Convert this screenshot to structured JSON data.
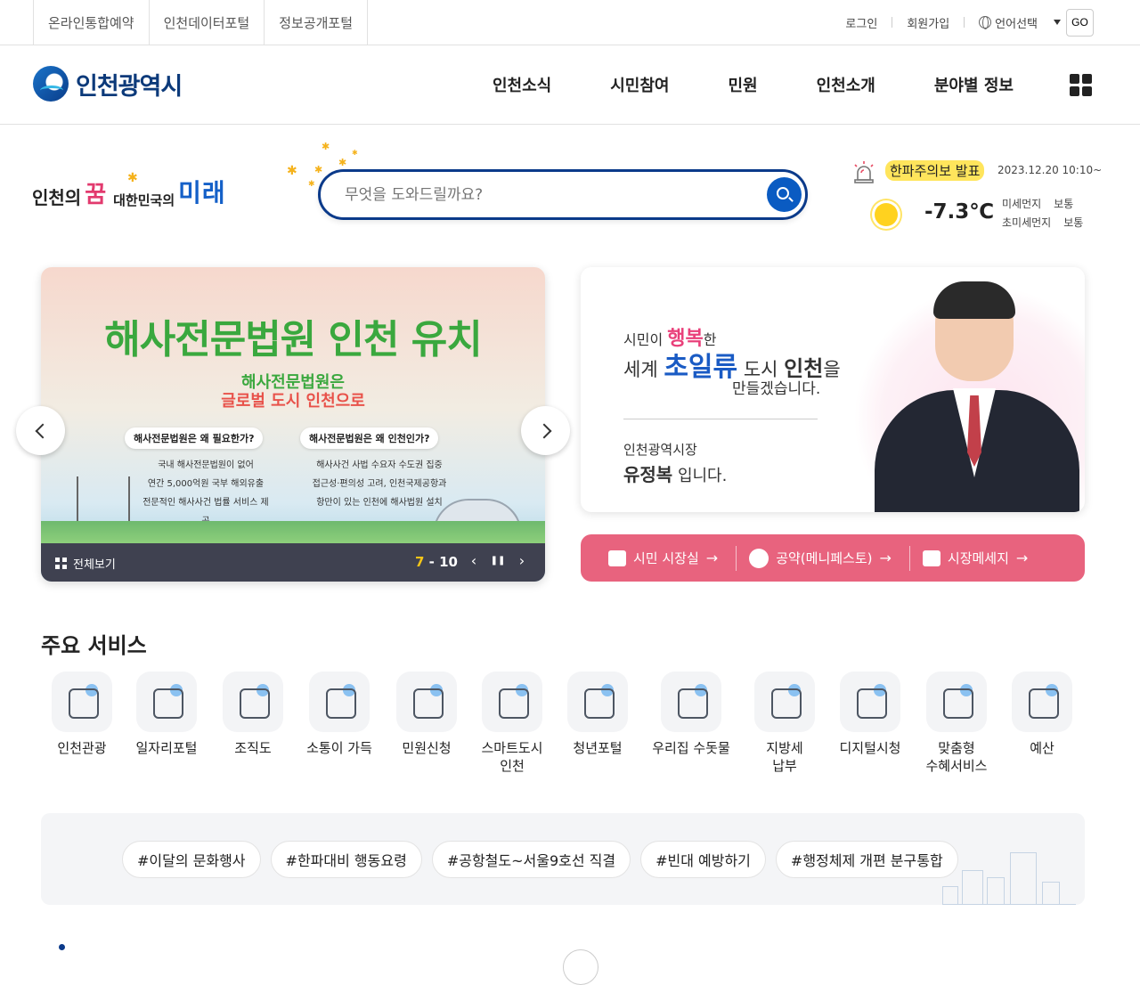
{
  "util": {
    "links": [
      "온라인통합예약",
      "인천데이터포털",
      "정보공개포털"
    ],
    "login": "로그인",
    "signup": "회원가입",
    "language": "언어선택",
    "go": "GO"
  },
  "header": {
    "logo_text": "인천광역시",
    "nav": [
      "인천소식",
      "시민참여",
      "민원",
      "인천소개",
      "분야별 정보"
    ]
  },
  "slogan": {
    "part1": "인천의",
    "part2": "꿈",
    "part3": "대한민국의",
    "part4": "미래"
  },
  "search": {
    "placeholder": "무엇을 도와드릴까요?"
  },
  "weather": {
    "alert": "한파주의보 발표",
    "datetime": "2023.12.20 10:10~",
    "temperature": "-7.3℃",
    "dust_label": "미세먼지",
    "dust_value": "보통",
    "fine_dust_label": "초미세먼지",
    "fine_dust_value": "보통"
  },
  "slider": {
    "title": "해사전문법원 인천 유치",
    "subtitle1": "해사전문법원은",
    "subtitle2": "글로벌 도시 인천으로",
    "q1": "해사전문법원은 왜 필요한가?",
    "q2": "해사전문법원은 왜 인천인가?",
    "col1": [
      "국내 해사전문법원이 없어",
      "연간 5,000억원 국부 해외유출",
      "전문적인 해사사건 법률 서비스 제공"
    ],
    "col2": [
      "해사사건 사법 수요자 수도권 집중",
      "접근성·편의성 고려, 인천국제공항과",
      "항만이 있는 인천에 해사법원 설치"
    ],
    "view_all": "전체보기",
    "current": "7",
    "total": "10",
    "prev": "‹",
    "pause": "❚❚",
    "next": "›"
  },
  "mayor": {
    "line1_a": "시민이",
    "line1_b": "행복",
    "line1_c": "한",
    "line2_a": "세계",
    "line2_b": "초일류",
    "line2_c": "도시",
    "line2_d": "인천",
    "line2_e": "을",
    "line3": "만들겠습니다.",
    "role": "인천광역시장",
    "name": "유정복",
    "name_suffix": "입니다.",
    "links": [
      "시민 시장실",
      "공약(메니페스토)",
      "시장메세지"
    ]
  },
  "services": {
    "title": "주요 서비스",
    "items": [
      [
        "인천관광"
      ],
      [
        "일자리포털"
      ],
      [
        "조직도"
      ],
      [
        "소통이 가득"
      ],
      [
        "민원신청"
      ],
      [
        "스마트도시",
        "인천"
      ],
      [
        "청년포털"
      ],
      [
        "우리집 수돗물"
      ],
      [
        "지방세",
        "납부"
      ],
      [
        "디지털시청"
      ],
      [
        "맞춤형",
        "수혜서비스"
      ],
      [
        "예산"
      ]
    ]
  },
  "hashtags": [
    "#이달의 문화행사",
    "#한파대비 행동요령",
    "#공항철도~서울9호선 직결",
    "#빈대 예방하기",
    "#행정체제 개편 분구통합"
  ]
}
